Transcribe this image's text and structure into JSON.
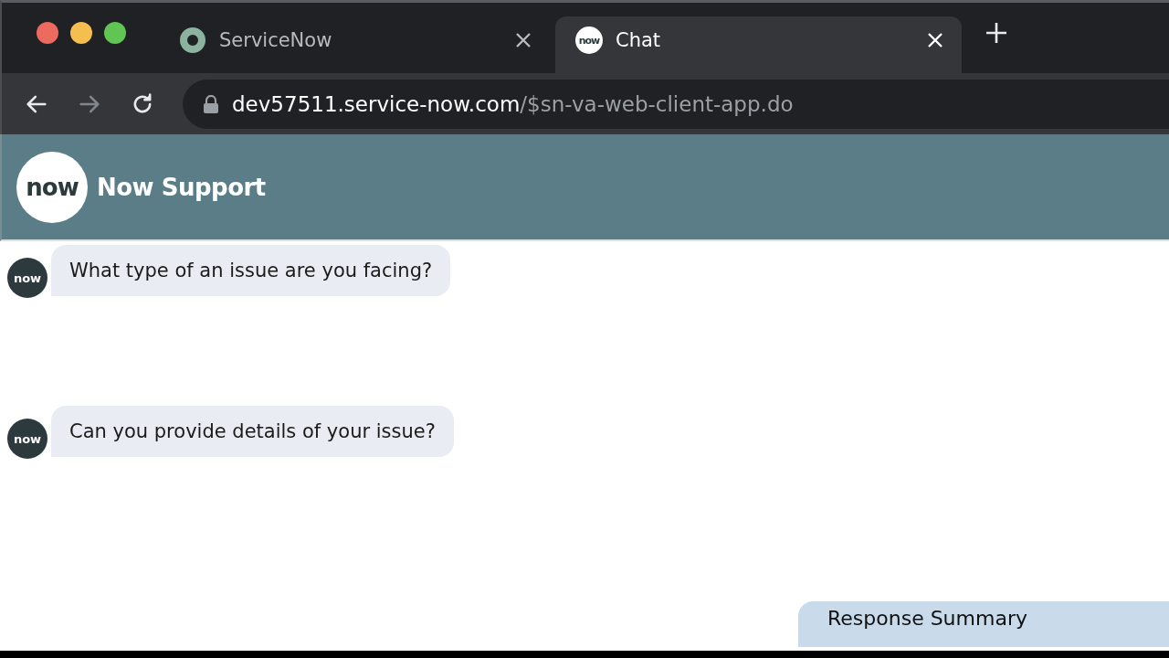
{
  "browser": {
    "window_controls": [
      {
        "color": "#ec6a5e"
      },
      {
        "color": "#f4bf4f"
      },
      {
        "color": "#61c554"
      }
    ],
    "tabs": [
      {
        "title": "ServiceNow",
        "kind": "ring",
        "selected": false
      },
      {
        "title": "Chat",
        "kind": "logo",
        "selected": true,
        "favicon_text": "now"
      }
    ],
    "address": {
      "host": "dev57511.service-now.com",
      "path": "/$sn-va-web-client-app.do"
    }
  },
  "header": {
    "logo_text": "now",
    "title": "Now Support"
  },
  "messages": [
    {
      "avatar_text": "now",
      "text": "What type of an issue are you facing?"
    },
    {
      "avatar_text": "now",
      "text": "Can you provide details of your issue?"
    }
  ],
  "summary": {
    "title": "Response Summary"
  }
}
